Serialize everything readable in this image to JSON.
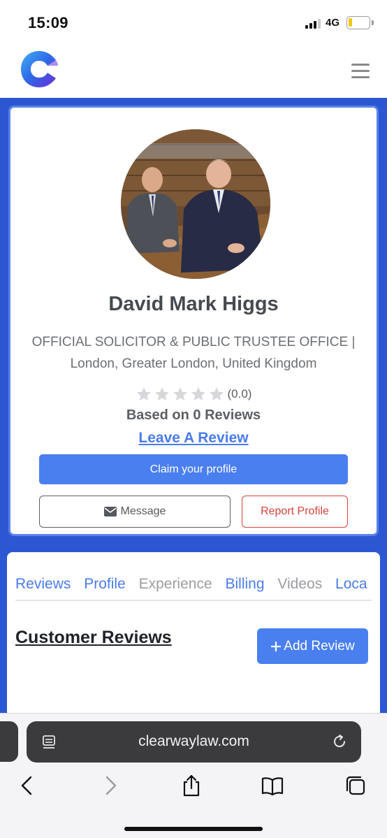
{
  "status_bar": {
    "time": "15:09",
    "network": "4G",
    "battery_level": 0.2,
    "battery_color": "#f3c614"
  },
  "header": {
    "logo_icon": "clearway-logo-icon",
    "menu_icon": "hamburger-menu-icon"
  },
  "profile": {
    "name": "David Mark Higgs",
    "organization": "OFFICIAL SOLICITOR & PUBLIC TRUSTEE OFFICE |",
    "location": "London, Greater London, United Kingdom",
    "rating": "(0.0)",
    "stars_filled": 0,
    "stars_total": 5,
    "based_on": "Based on 0 Reviews",
    "leave_review": "Leave A Review",
    "claim_label": "Claim your profile",
    "message_label": "Message",
    "report_label": "Report Profile"
  },
  "tabs": [
    {
      "label": "Reviews"
    },
    {
      "label": "Profile"
    },
    {
      "label": "Experience"
    },
    {
      "label": "Billing"
    },
    {
      "label": "Videos"
    },
    {
      "label": "Loca"
    }
  ],
  "reviews": {
    "title": "Customer Reviews",
    "add_label": "Add Review"
  },
  "browser": {
    "url": "clearwaylaw.com"
  },
  "colors": {
    "brand_blue": "#2c57d3",
    "button_blue": "#4a7ff0",
    "link_blue": "#4a7cea",
    "danger_red": "#d2443a"
  }
}
